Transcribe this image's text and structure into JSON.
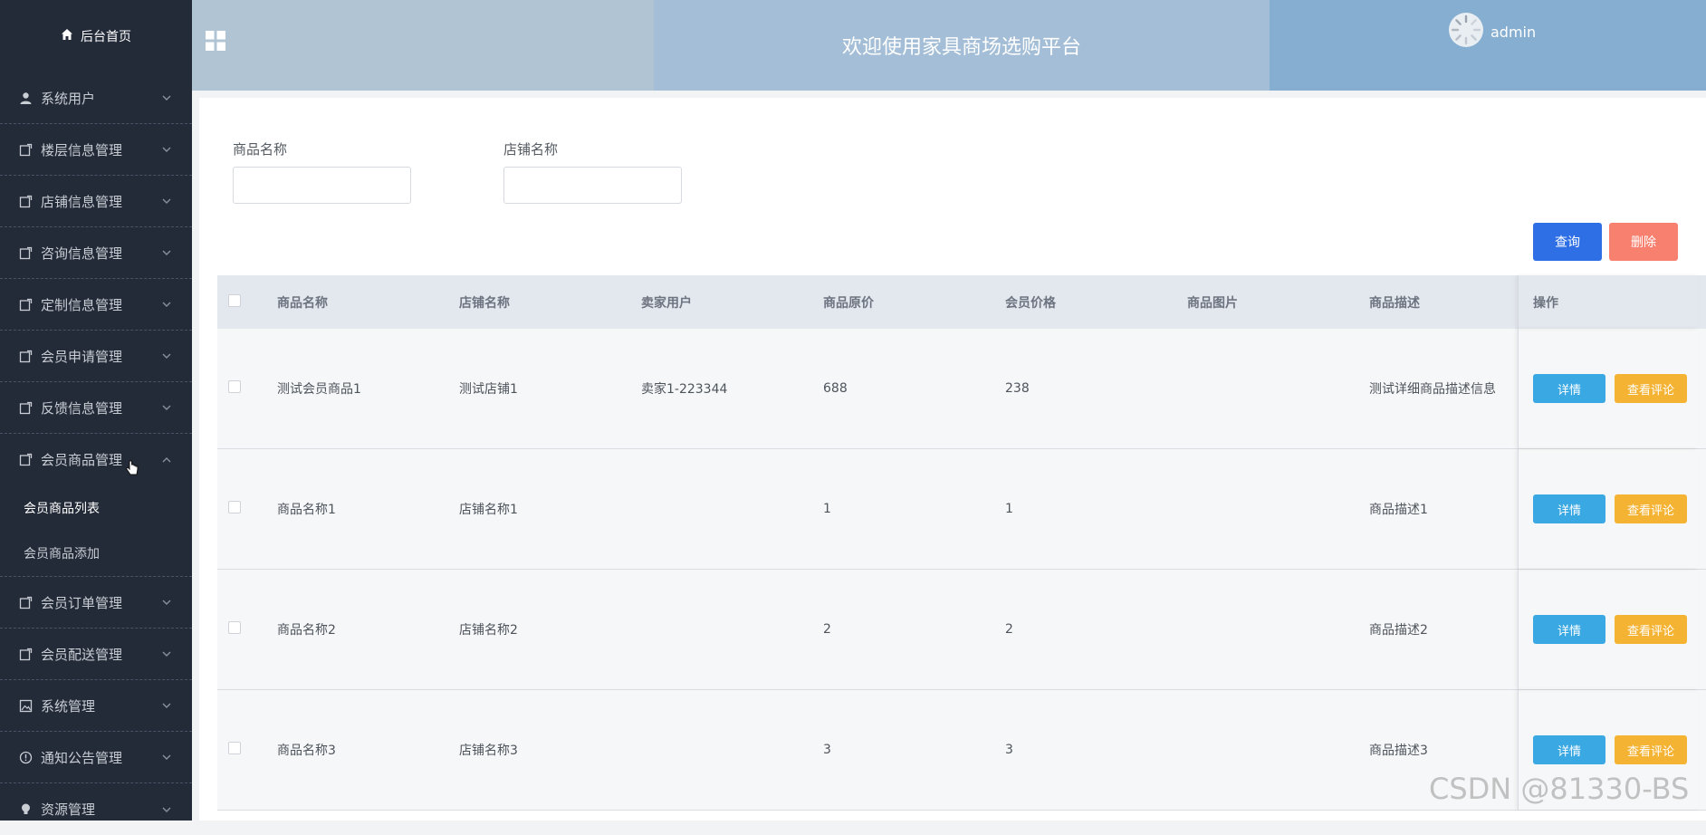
{
  "sidebar": {
    "home": "后台首页",
    "items": [
      {
        "label": "系统用户",
        "icon": "user-icon"
      },
      {
        "label": "楼层信息管理",
        "icon": "folder-icon"
      },
      {
        "label": "店铺信息管理",
        "icon": "folder-icon"
      },
      {
        "label": "咨询信息管理",
        "icon": "folder-icon"
      },
      {
        "label": "定制信息管理",
        "icon": "folder-icon"
      },
      {
        "label": "会员申请管理",
        "icon": "folder-icon"
      },
      {
        "label": "反馈信息管理",
        "icon": "folder-icon"
      },
      {
        "label": "会员商品管理",
        "icon": "folder-icon",
        "expanded": true
      },
      {
        "label": "会员订单管理",
        "icon": "folder-icon"
      },
      {
        "label": "会员配送管理",
        "icon": "folder-icon"
      },
      {
        "label": "系统管理",
        "icon": "image-icon"
      },
      {
        "label": "通知公告管理",
        "icon": "info-icon"
      },
      {
        "label": "资源管理",
        "icon": "bulb-icon"
      }
    ],
    "submenu": [
      {
        "label": "会员商品列表",
        "active": true
      },
      {
        "label": "会员商品添加",
        "active": false
      }
    ]
  },
  "header": {
    "title": "欢迎使用家具商场选购平台",
    "user": "admin"
  },
  "filters": {
    "name_label": "商品名称",
    "shop_label": "店铺名称",
    "name_value": "",
    "shop_value": ""
  },
  "actions": {
    "query": "查询",
    "delete": "删除"
  },
  "table": {
    "headers": [
      "商品名称",
      "店铺名称",
      "卖家用户",
      "商品原价",
      "会员价格",
      "商品图片",
      "商品描述",
      "操作"
    ],
    "rows": [
      {
        "name": "测试会员商品1",
        "shop": "测试店铺1",
        "seller": "卖家1-223344",
        "price": "688",
        "vip": "238",
        "image": "",
        "desc": "测试详细商品描述信息"
      },
      {
        "name": "商品名称1",
        "shop": "店铺名称1",
        "seller": "",
        "price": "1",
        "vip": "1",
        "image": "",
        "desc": "商品描述1"
      },
      {
        "name": "商品名称2",
        "shop": "店铺名称2",
        "seller": "",
        "price": "2",
        "vip": "2",
        "image": "",
        "desc": "商品描述2"
      },
      {
        "name": "商品名称3",
        "shop": "店铺名称3",
        "seller": "",
        "price": "3",
        "vip": "3",
        "image": "",
        "desc": "商品描述3"
      }
    ],
    "detail_label": "详情",
    "review_label": "查看评论"
  },
  "watermark": "CSDN @81330-BS",
  "colors": {
    "sidebar_bg": "#232a38",
    "query_btn": "#2f6fe6",
    "delete_btn": "#f8806f",
    "detail_btn": "#3aa8e3",
    "review_btn": "#f5b334"
  }
}
